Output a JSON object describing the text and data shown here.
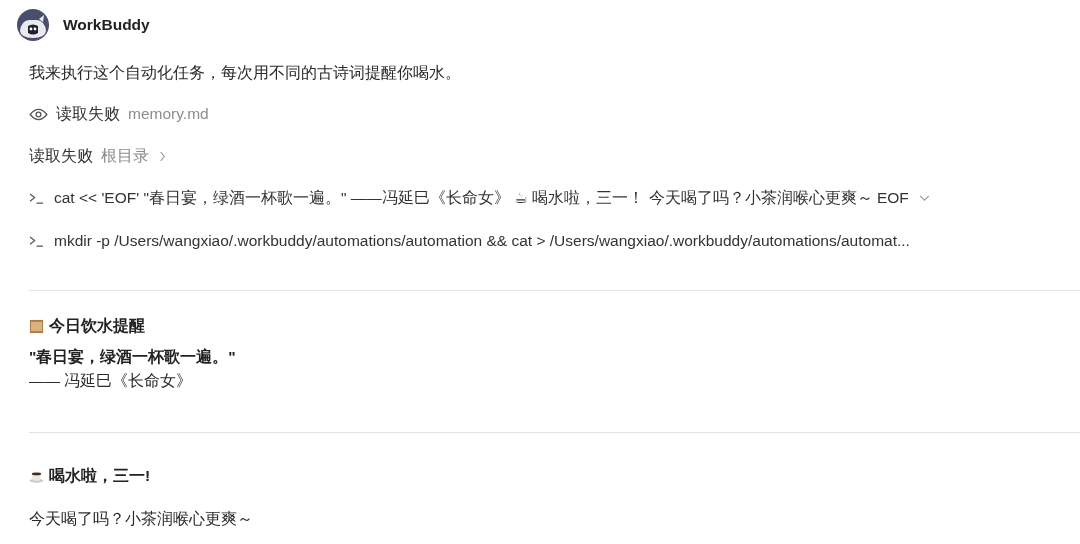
{
  "header": {
    "name": "WorkBuddy"
  },
  "intro": "我来执行这个自动化任务，每次用不同的古诗词提醒你喝水。",
  "reads": [
    {
      "kind": "file",
      "label": "读取失败",
      "target": "memory.md"
    },
    {
      "kind": "folder",
      "label": "读取失败",
      "target": "根目录"
    }
  ],
  "commands": [
    {
      "text": "cat << 'EOF' \"春日宴，绿酒一杯歌一遍。\" ——冯延巳《长命女》 ☕ 喝水啦，三一！ 今天喝了吗？小茶润喉心更爽～ EOF",
      "expandable": true
    },
    {
      "text": "mkdir -p /Users/wangxiao/.workbuddy/automations/automation && cat > /Users/wangxiao/.workbuddy/automations/automat...",
      "expandable": false
    }
  ],
  "sections": [
    {
      "kind": "scroll",
      "heading": "今日饮水提醒",
      "lines": [
        {
          "text": "\"春日宴，绿酒一杯歌一遍。\"",
          "bold": true
        },
        {
          "text": "—— 冯延巳《长命女》",
          "bold": false
        }
      ]
    },
    {
      "kind": "coffee",
      "heading": "喝水啦，三一!",
      "lines": [
        {
          "text": "今天喝了吗？小茶润喉心更爽～",
          "bold": false
        }
      ]
    }
  ]
}
